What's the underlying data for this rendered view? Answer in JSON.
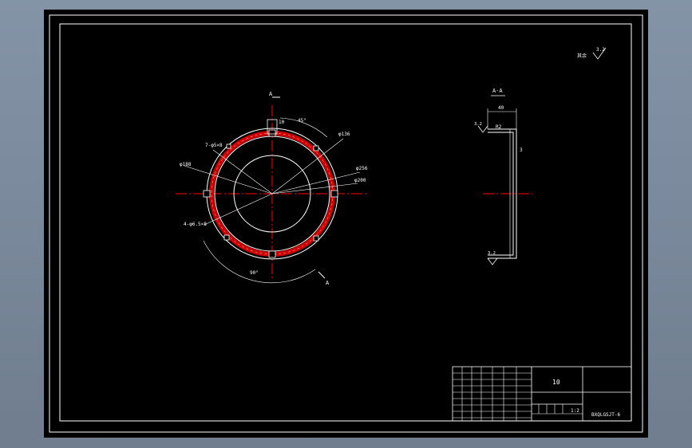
{
  "drawing": {
    "section_label": "A-A",
    "cut_marker_top": "A",
    "cut_marker_bottom": "A",
    "roughness_note_label": "其余",
    "roughness_note_value": "3.2",
    "front_view": {
      "width_label": "10",
      "top_angle": "45°",
      "bottom_angle": "90°",
      "dia_label_1": "φ136",
      "dia_label_2": "φ256",
      "dia_label_3": "φ200",
      "dia_label_4": "φ188",
      "hole_label_1": "7-φ5×8",
      "hole_label_2": "4-φ6.5×8"
    },
    "section_view": {
      "flange_width": "40",
      "fillet_label": "R2",
      "thickness_label": "3",
      "roughness_top": "3.2",
      "roughness_bottom": "3.2"
    }
  },
  "title_block": {
    "part_number": "10",
    "scale": "1:2",
    "drawing_code": "BXQLGSJT-6"
  },
  "colors": {
    "paper": "#000000",
    "line": "#ffffff",
    "center_line": "#ff0000",
    "ring_fill": "#cc0000",
    "outer_bg": "#7f8d9e"
  }
}
